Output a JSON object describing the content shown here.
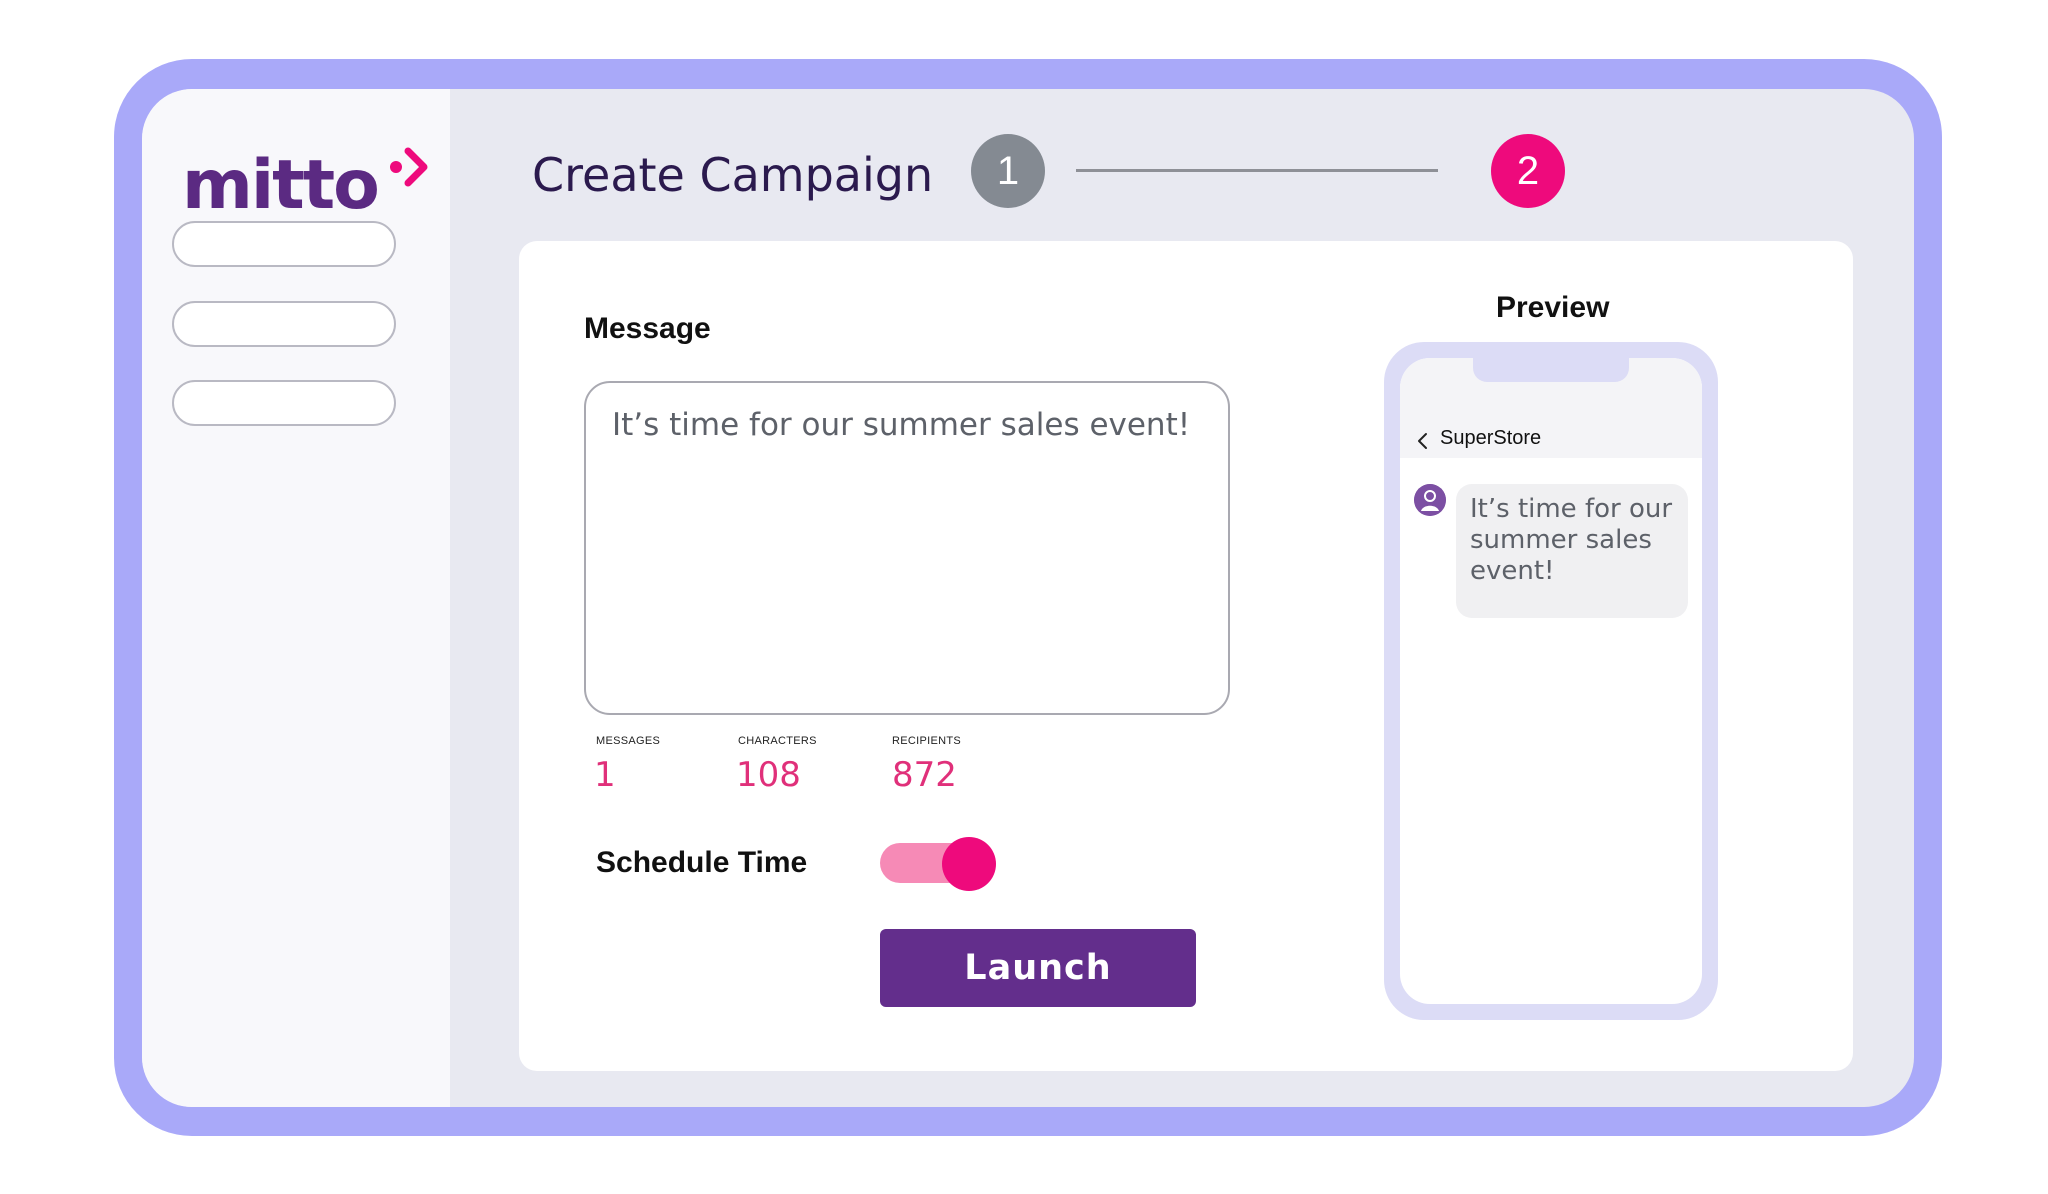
{
  "brand": {
    "logo_text": "mitto",
    "icon": "chevron-mark-icon",
    "colors": {
      "purple": "#5b2a82",
      "pink": "#ee0a7c",
      "frame": "#a9a9f9"
    }
  },
  "sidebar": {
    "items": [
      {
        "label": ""
      },
      {
        "label": ""
      },
      {
        "label": ""
      }
    ]
  },
  "header": {
    "title": "Create Campaign",
    "steps": [
      {
        "number": "1",
        "status": "complete"
      },
      {
        "number": "2",
        "status": "active"
      }
    ]
  },
  "form": {
    "message_label": "Message",
    "message_text": "It’s time for our summer sales event!",
    "stats": [
      {
        "label": "MESSAGES",
        "value": "1"
      },
      {
        "label": "CHARACTERS",
        "value": "108"
      },
      {
        "label": "RECIPIENTS",
        "value": "872"
      }
    ],
    "schedule_label": "Schedule Time",
    "schedule_enabled": true,
    "launch_label": "Launch"
  },
  "preview": {
    "title": "Preview",
    "contact": "SuperStore",
    "back_icon": "chevron-left-icon",
    "avatar_icon": "user-avatar-icon",
    "message": "It’s time for our summer sales event!"
  }
}
